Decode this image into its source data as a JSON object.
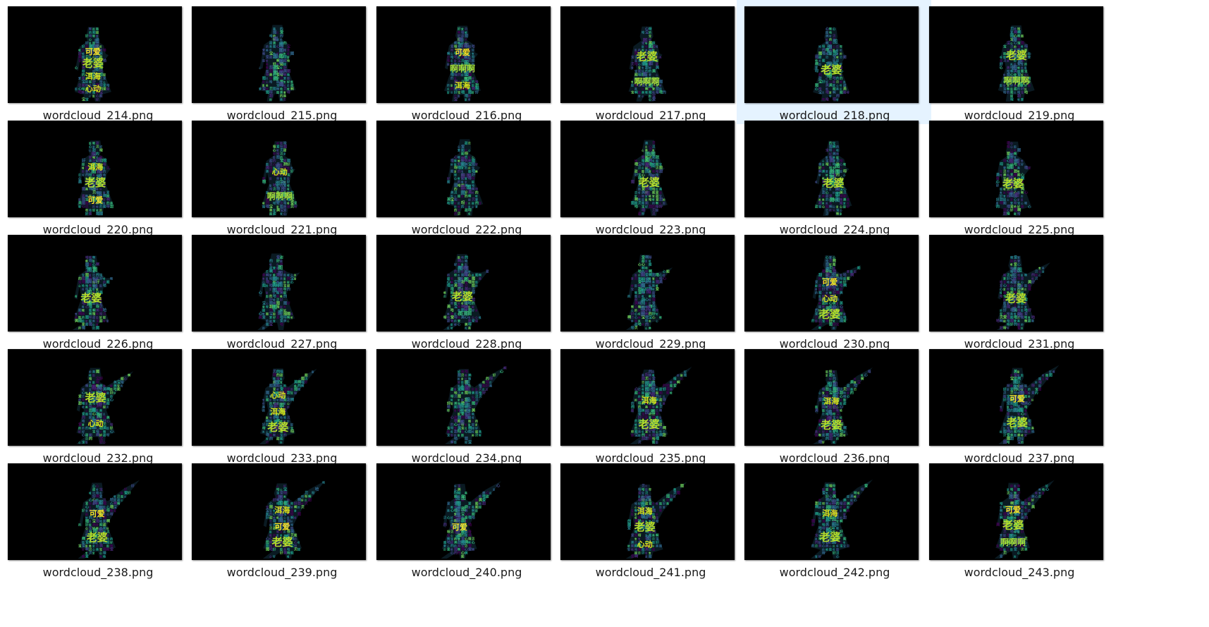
{
  "files": [
    {
      "name": "wordcloud_214.png",
      "words": [
        "可爱",
        "老婆",
        "洱海",
        "心动"
      ]
    },
    {
      "name": "wordcloud_215.png",
      "words": []
    },
    {
      "name": "wordcloud_216.png",
      "words": [
        "可爱",
        "啊啊啊",
        "洱海"
      ]
    },
    {
      "name": "wordcloud_217.png",
      "words": [
        "老婆",
        "啊啊啊"
      ]
    },
    {
      "name": "wordcloud_218.png",
      "words": [
        "老婆"
      ],
      "selected": true
    },
    {
      "name": "wordcloud_219.png",
      "words": [
        "老婆",
        "啊啊啊"
      ]
    },
    {
      "name": "wordcloud_220.png",
      "words": [
        "洱海",
        "老婆",
        "可爱"
      ]
    },
    {
      "name": "wordcloud_221.png",
      "words": [
        "心动",
        "啊啊啊"
      ]
    },
    {
      "name": "wordcloud_222.png",
      "words": []
    },
    {
      "name": "wordcloud_223.png",
      "words": [
        "老婆"
      ]
    },
    {
      "name": "wordcloud_224.png",
      "words": [
        "老婆"
      ]
    },
    {
      "name": "wordcloud_225.png",
      "words": [
        "老婆"
      ]
    },
    {
      "name": "wordcloud_226.png",
      "words": [
        "老婆"
      ]
    },
    {
      "name": "wordcloud_227.png",
      "words": []
    },
    {
      "name": "wordcloud_228.png",
      "words": [
        "老婆"
      ]
    },
    {
      "name": "wordcloud_229.png",
      "words": []
    },
    {
      "name": "wordcloud_230.png",
      "words": [
        "可爱",
        "心动",
        "老婆"
      ]
    },
    {
      "name": "wordcloud_231.png",
      "words": [
        "老婆"
      ]
    },
    {
      "name": "wordcloud_232.png",
      "words": [
        "老婆",
        "心动"
      ]
    },
    {
      "name": "wordcloud_233.png",
      "words": [
        "心动",
        "洱海",
        "老婆"
      ]
    },
    {
      "name": "wordcloud_234.png",
      "words": []
    },
    {
      "name": "wordcloud_235.png",
      "words": [
        "洱海",
        "老婆"
      ]
    },
    {
      "name": "wordcloud_236.png",
      "words": [
        "洱海",
        "老婆"
      ]
    },
    {
      "name": "wordcloud_237.png",
      "words": [
        "可爱",
        "老婆"
      ]
    },
    {
      "name": "wordcloud_238.png",
      "words": [
        "可爱",
        "老婆"
      ]
    },
    {
      "name": "wordcloud_239.png",
      "words": [
        "洱海",
        "可爱",
        "老婆"
      ]
    },
    {
      "name": "wordcloud_240.png",
      "words": [
        "可爱"
      ]
    },
    {
      "name": "wordcloud_241.png",
      "words": [
        "洱海",
        "老婆",
        "心动"
      ]
    },
    {
      "name": "wordcloud_242.png",
      "words": [
        "洱海",
        "老婆"
      ]
    },
    {
      "name": "wordcloud_243.png",
      "words": [
        "可爱",
        "老婆",
        "啊啊啊"
      ]
    }
  ],
  "palette": [
    "#fde725",
    "#b5de2b",
    "#6ece58",
    "#35b779",
    "#1f9e89",
    "#26828e",
    "#31688e",
    "#3e4989",
    "#482878",
    "#440154"
  ]
}
